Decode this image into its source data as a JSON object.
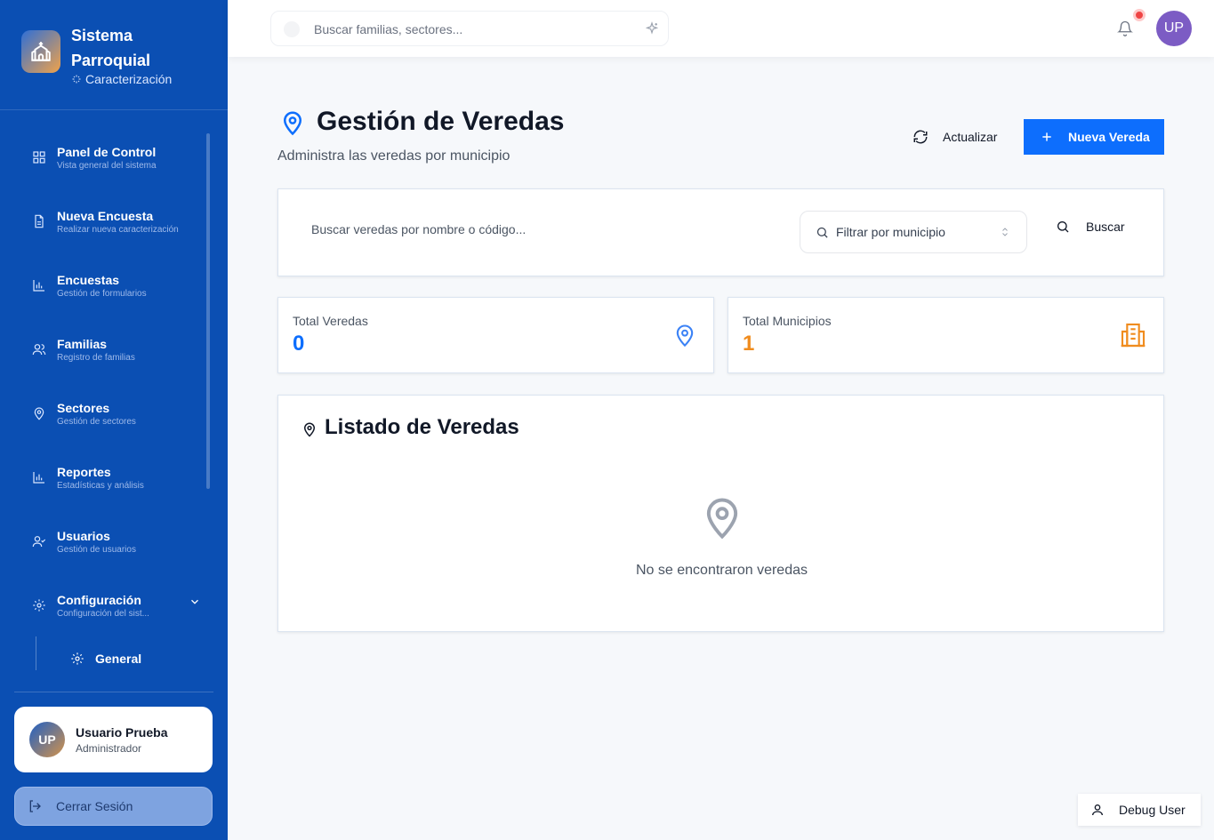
{
  "brand": {
    "title": "Sistema Parroquial",
    "subtitle": "Caracterización"
  },
  "sidebar": {
    "items": [
      {
        "label": "Panel de Control",
        "sub": "Vista general del sistema",
        "icon": "dashboard-icon"
      },
      {
        "label": "Nueva Encuesta",
        "sub": "Realizar nueva caracterización",
        "icon": "document-icon"
      },
      {
        "label": "Encuestas",
        "sub": "Gestión de formularios",
        "icon": "bar-chart-icon"
      },
      {
        "label": "Familias",
        "sub": "Registro de familias",
        "icon": "users-icon"
      },
      {
        "label": "Sectores",
        "sub": "Gestión de sectores",
        "icon": "map-pin-icon"
      },
      {
        "label": "Reportes",
        "sub": "Estadísticas y análisis",
        "icon": "bar-chart-icon"
      },
      {
        "label": "Usuarios",
        "sub": "Gestión de usuarios",
        "icon": "user-check-icon"
      },
      {
        "label": "Configuración",
        "sub": "Configuración del sist...",
        "icon": "gear-icon"
      }
    ],
    "subitem": {
      "label": "General"
    }
  },
  "user": {
    "initials": "UP",
    "name": "Usuario Prueba",
    "role": "Administrador"
  },
  "logout_label": "Cerrar Sesión",
  "topbar": {
    "search_placeholder": "Buscar familias, sectores...",
    "avatar_initials": "UP"
  },
  "page": {
    "title": "Gestión de Veredas",
    "subtitle": "Administra las veredas por municipio",
    "refresh_label": "Actualizar",
    "new_label": "Nueva Vereda"
  },
  "filters": {
    "search_placeholder": "Buscar veredas por nombre o código...",
    "municipio_placeholder": "Filtrar por municipio",
    "search_button": "Buscar"
  },
  "stats": [
    {
      "label": "Total Veredas",
      "value": "0",
      "color": "#0d6efd"
    },
    {
      "label": "Total Municipios",
      "value": "1",
      "color": "#f08c1e"
    }
  ],
  "list": {
    "title": "Listado de Veredas",
    "empty_text": "No se encontraron veredas"
  },
  "debug_label": "Debug User",
  "colors": {
    "sidebar": "#0b4fb3",
    "primary": "#0d6efd",
    "accent": "#f08c1e"
  }
}
